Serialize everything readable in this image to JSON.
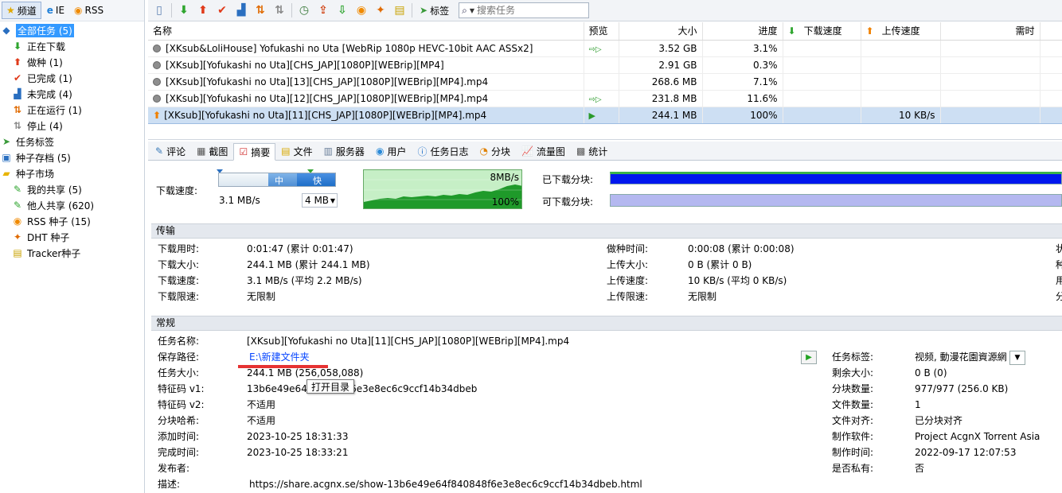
{
  "left_tabs": [
    {
      "label": "频道",
      "icon": "star-icon"
    },
    {
      "label": "IE",
      "icon": "ie-icon"
    },
    {
      "label": "RSS",
      "icon": "rss-icon"
    }
  ],
  "tree": [
    {
      "label": "全部任务 (5)",
      "level": 0,
      "icon": "all-tasks-icon",
      "selected": true
    },
    {
      "label": "正在下载",
      "level": 1,
      "icon": "down-arrow-icon"
    },
    {
      "label": "做种 (1)",
      "level": 1,
      "icon": "up-arrow-icon"
    },
    {
      "label": "已完成 (1)",
      "level": 1,
      "icon": "check-icon"
    },
    {
      "label": "未完成 (4)",
      "level": 1,
      "icon": "incomplete-icon"
    },
    {
      "label": "正在运行 (1)",
      "level": 1,
      "icon": "running-icon"
    },
    {
      "label": "停止 (4)",
      "level": 1,
      "icon": "stop-icon"
    },
    {
      "label": "任务标签",
      "level": 0,
      "icon": "tag-icon"
    },
    {
      "label": "种子存档 (5)",
      "level": 0,
      "icon": "archive-icon"
    },
    {
      "label": "种子市场",
      "level": 0,
      "icon": "folder-icon"
    },
    {
      "label": "我的共享 (5)",
      "level": 1,
      "icon": "share-icon"
    },
    {
      "label": "他人共享 (620)",
      "level": 1,
      "icon": "others-share-icon"
    },
    {
      "label": "RSS 种子 (15)",
      "level": 1,
      "icon": "rss-icon"
    },
    {
      "label": "DHT 种子",
      "level": 1,
      "icon": "dht-icon"
    },
    {
      "label": "Tracker种子",
      "level": 1,
      "icon": "tracker-icon"
    }
  ],
  "toolbar": {
    "tag_label": "标签",
    "search_placeholder": "搜索任务"
  },
  "task_table": {
    "headers": {
      "name": "名称",
      "preview": "预览",
      "size": "大小",
      "progress": "进度",
      "down_speed": "下载速度",
      "up_speed": "上传速度",
      "eta": "需时"
    },
    "rows": [
      {
        "name": "[XKsub&LoliHouse] Yofukashi no Uta [WebRip 1080p HEVC-10bit AAC ASSx2]",
        "size": "3.52 GB",
        "progress": "3.1%",
        "up_speed": "",
        "status": "stopped",
        "preview": true
      },
      {
        "name": "[XKsub][Yofukashi no Uta][CHS_JAP][1080P][WEBrip][MP4]",
        "size": "2.91 GB",
        "progress": "0.3%",
        "up_speed": "",
        "status": "stopped",
        "preview": false
      },
      {
        "name": "[XKsub][Yofukashi no Uta][13][CHS_JAP][1080P][WEBrip][MP4].mp4",
        "size": "268.6 MB",
        "progress": "7.1%",
        "up_speed": "",
        "status": "stopped",
        "preview": false
      },
      {
        "name": "[XKsub][Yofukashi no Uta][12][CHS_JAP][1080P][WEBrip][MP4].mp4",
        "size": "231.8 MB",
        "progress": "11.6%",
        "up_speed": "",
        "status": "stopped",
        "preview": true
      },
      {
        "name": "[XKsub][Yofukashi no Uta][11][CHS_JAP][1080P][WEBrip][MP4].mp4",
        "size": "244.1 MB",
        "progress": "100%",
        "up_speed": "10 KB/s",
        "status": "seeding",
        "preview": true,
        "selected": true
      }
    ]
  },
  "detail_tabs": [
    {
      "label": "评论",
      "icon": "comment-icon"
    },
    {
      "label": "截图",
      "icon": "screenshot-icon"
    },
    {
      "label": "摘要",
      "icon": "summary-icon",
      "active": true
    },
    {
      "label": "文件",
      "icon": "file-icon"
    },
    {
      "label": "服务器",
      "icon": "server-icon"
    },
    {
      "label": "用户",
      "icon": "users-icon"
    },
    {
      "label": "任务日志",
      "icon": "log-icon"
    },
    {
      "label": "分块",
      "icon": "pieces-icon"
    },
    {
      "label": "流量图",
      "icon": "traffic-chart-icon"
    },
    {
      "label": "统计",
      "icon": "stats-icon"
    }
  ],
  "speed": {
    "label": "下载速度:",
    "slider_mid": "中",
    "slider_fast": "快",
    "current": "3.1 MB/s",
    "limit": "4 MB",
    "graph_max": "8MB/s",
    "graph_pct": "100%",
    "downloaded_pieces_label": "已下载分块:",
    "available_pieces_label": "可下载分块:"
  },
  "transfer": {
    "title": "传输",
    "left": [
      {
        "k": "下载用时:",
        "v": "0:01:47 (累计 0:01:47)"
      },
      {
        "k": "下载大小:",
        "v": "244.1 MB (累计 244.1 MB)"
      },
      {
        "k": "下载速度:",
        "v": "3.1 MB/s (平均 2.2 MB/s)"
      },
      {
        "k": "下载限速:",
        "v": "无限制"
      }
    ],
    "right": [
      {
        "k": "做种时间:",
        "v": "0:00:08 (累计 0:00:08)"
      },
      {
        "k": "上传大小:",
        "v": "0 B (累计 0 B)"
      },
      {
        "k": "上传速度:",
        "v": "10 KB/s (平均 0 KB/s)"
      },
      {
        "k": "上传限速:",
        "v": "无限制"
      }
    ],
    "edge": [
      "状",
      "种",
      "用",
      "分"
    ]
  },
  "general": {
    "title": "常规",
    "left": [
      {
        "k": "任务名称:",
        "v": "[XKsub][Yofukashi no Uta][11][CHS_JAP][1080P][WEBrip][MP4].mp4"
      },
      {
        "k": "保存路径:",
        "v": "E:\\新建文件夹"
      },
      {
        "k": "任务大小:",
        "v": "244.1 MB (256,058,088)"
      },
      {
        "k": "特征码 v1:",
        "v": "13b6e49e64f840848f6e3e8ec6c9ccf14b34dbeb"
      },
      {
        "k": "特征码 v2:",
        "v": "不适用"
      },
      {
        "k": "分块哈希:",
        "v": "不适用"
      },
      {
        "k": "添加时间:",
        "v": "2023-10-25 18:31:33"
      },
      {
        "k": "完成时间:",
        "v": "2023-10-25 18:33:21"
      },
      {
        "k": "发布者:",
        "v": ""
      },
      {
        "k": "描述:",
        "v": "https://share.acgnx.se/show-13b6e49e64f840848f6e3e8ec6c9ccf14b34dbeb.html"
      }
    ],
    "right": [
      {
        "k": "任务标签:",
        "v": "视频, 動漫花園資源網"
      },
      {
        "k": "剩余大小:",
        "v": "0 B (0)"
      },
      {
        "k": "分块数量:",
        "v": "977/977 (256.0 KB)"
      },
      {
        "k": "文件数量:",
        "v": "1"
      },
      {
        "k": "文件对齐:",
        "v": "已分块对齐"
      },
      {
        "k": "制作软件:",
        "v": "Project AcgnX Torrent Asia"
      },
      {
        "k": "制作时间:",
        "v": "2022-09-17 12:07:53"
      },
      {
        "k": "是否私有:",
        "v": "否"
      }
    ],
    "tooltip": "打开目录"
  },
  "colors": {
    "selection": "#3399ff",
    "row_selected": "#cddff3",
    "pieces_done": "#0017ee",
    "pieces_avail": "#b4b8f0",
    "link": "#0645ff",
    "annotation": "#e63232"
  }
}
